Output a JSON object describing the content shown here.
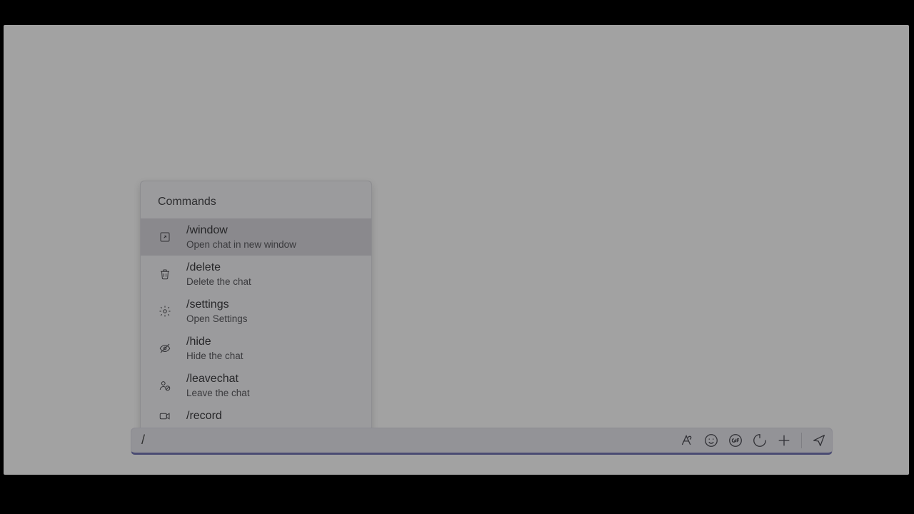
{
  "popup": {
    "header": "Commands",
    "items": [
      {
        "icon": "open-window-icon",
        "title": "/window",
        "desc": "Open chat in new window",
        "selected": true
      },
      {
        "icon": "trash-icon",
        "title": "/delete",
        "desc": "Delete the chat",
        "selected": false
      },
      {
        "icon": "gear-icon",
        "title": "/settings",
        "desc": "Open Settings",
        "selected": false
      },
      {
        "icon": "hide-icon",
        "title": "/hide",
        "desc": "Hide the chat",
        "selected": false
      },
      {
        "icon": "leave-icon",
        "title": "/leavechat",
        "desc": "Leave the chat",
        "selected": false
      },
      {
        "icon": "record-icon",
        "title": "/record",
        "desc": "",
        "selected": false
      }
    ]
  },
  "compose": {
    "value": "/",
    "icons": [
      {
        "name": "format-icon"
      },
      {
        "name": "emoji-icon"
      },
      {
        "name": "gif-icon"
      },
      {
        "name": "loop-icon"
      },
      {
        "name": "plus-icon"
      },
      {
        "name": "divider"
      },
      {
        "name": "send-icon"
      }
    ]
  }
}
